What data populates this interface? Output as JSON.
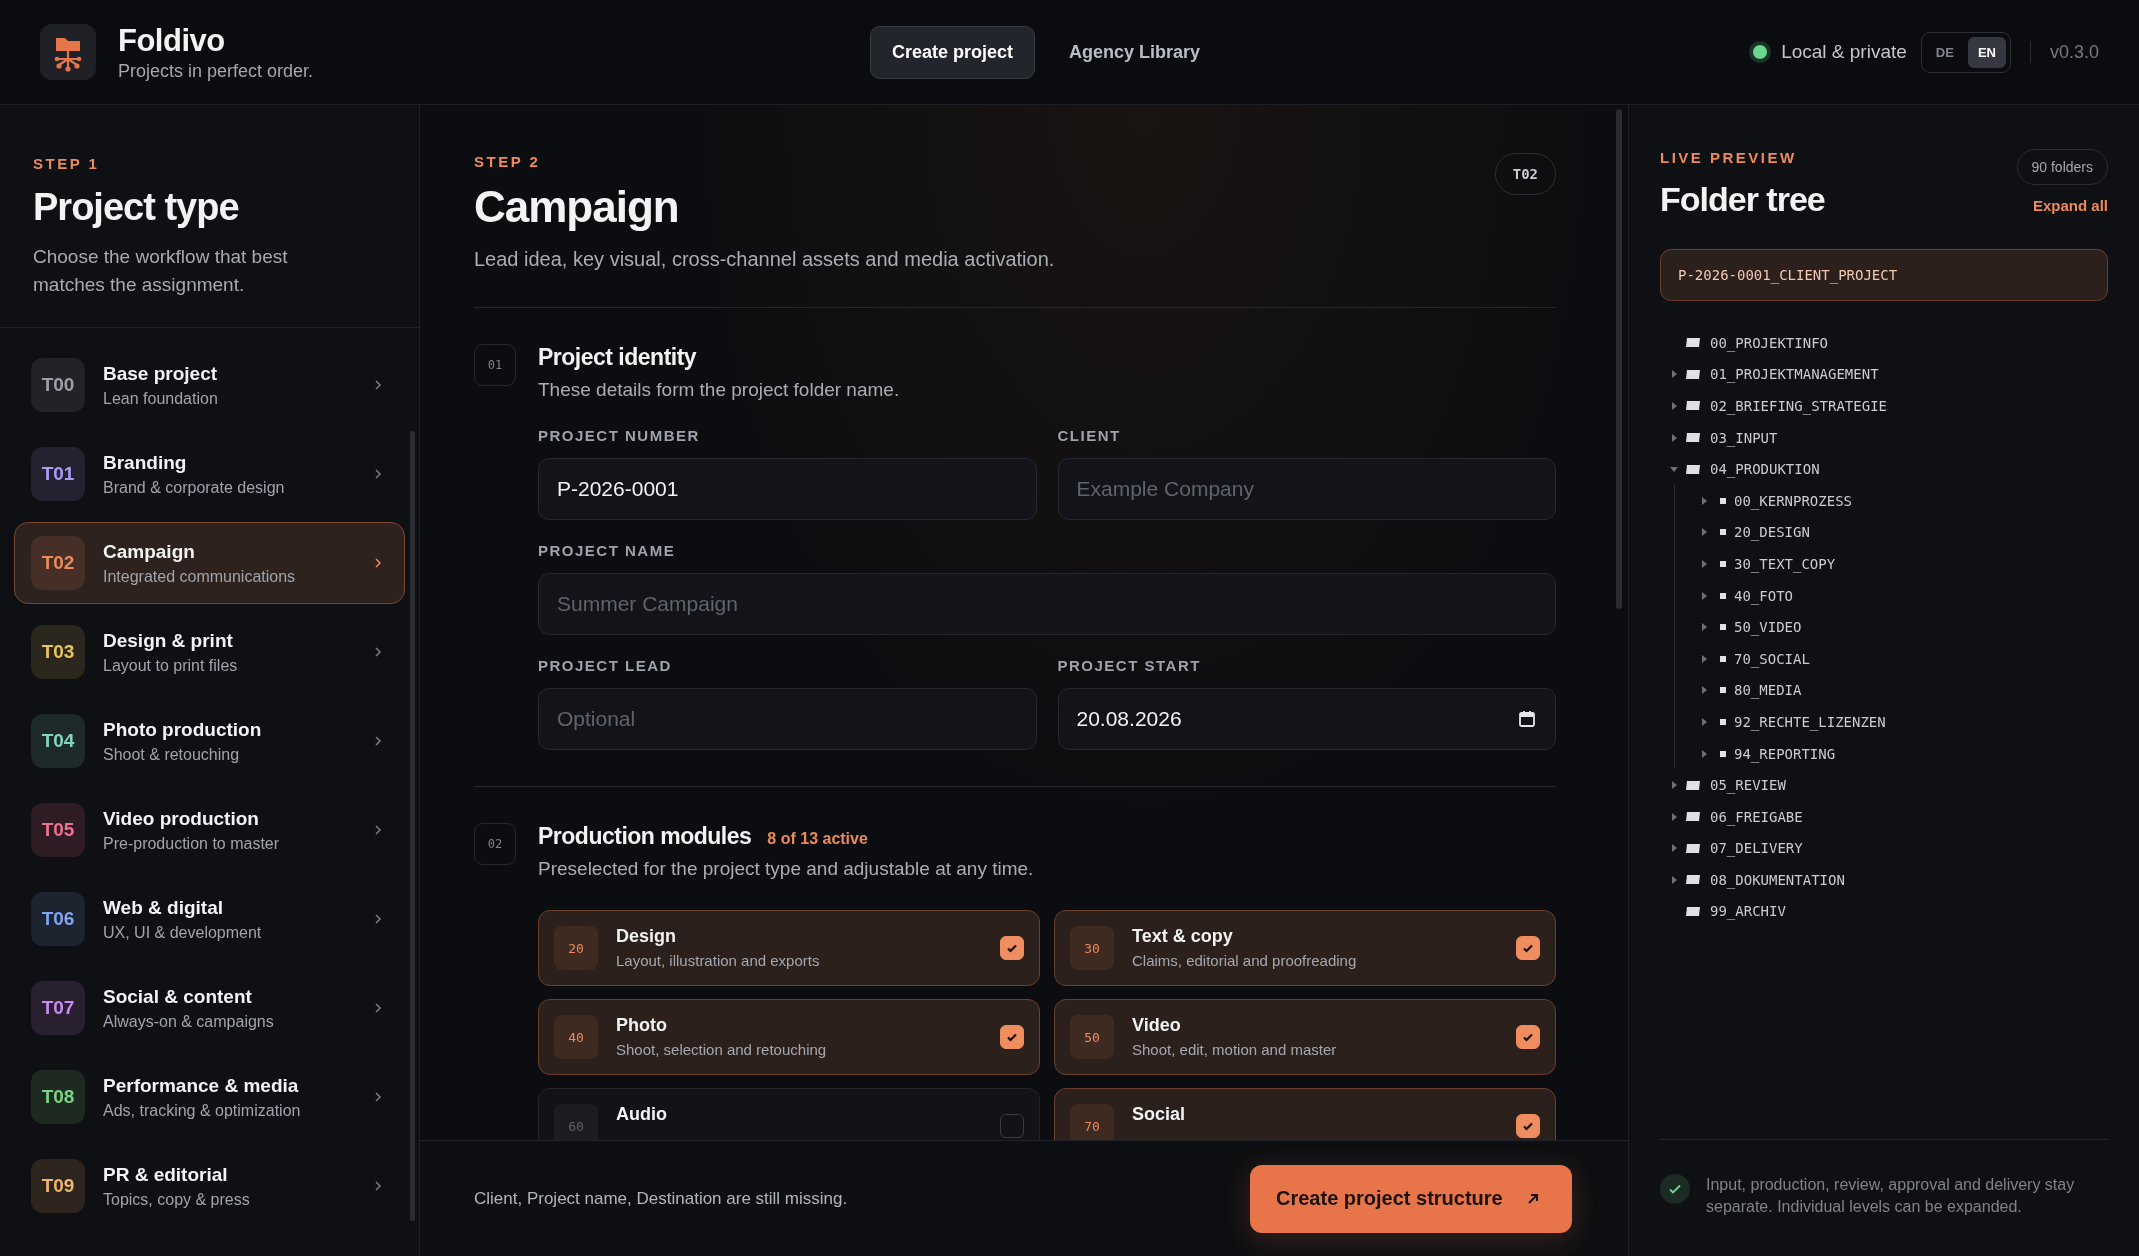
{
  "header": {
    "brand": "Foldivo",
    "tagline": "Projects in perfect order.",
    "nav": [
      {
        "label": "Create project",
        "selected": true
      },
      {
        "label": "Agency Library",
        "selected": false
      }
    ],
    "status": "Local & private",
    "languages": [
      {
        "label": "DE",
        "selected": false
      },
      {
        "label": "EN",
        "selected": true
      }
    ],
    "version": "v0.3.0"
  },
  "sidebar": {
    "step": "STEP 1",
    "title": "Project type",
    "description": "Choose the workflow that best matches the assignment.",
    "items": [
      {
        "code": "T00",
        "title": "Base project",
        "subtitle": "Lean foundation",
        "color": "#9ba0aa",
        "selected": false
      },
      {
        "code": "T01",
        "title": "Branding",
        "subtitle": "Brand & corporate design",
        "color": "#a99cf5",
        "selected": false
      },
      {
        "code": "T02",
        "title": "Campaign",
        "subtitle": "Integrated communications",
        "color": "#ec8a5b",
        "selected": true
      },
      {
        "code": "T03",
        "title": "Design & print",
        "subtitle": "Layout to print files",
        "color": "#e8c462",
        "selected": false
      },
      {
        "code": "T04",
        "title": "Photo production",
        "subtitle": "Shoot & retouching",
        "color": "#80d6bf",
        "selected": false
      },
      {
        "code": "T05",
        "title": "Video production",
        "subtitle": "Pre-production to master",
        "color": "#ee6f8f",
        "selected": false
      },
      {
        "code": "T06",
        "title": "Web & digital",
        "subtitle": "UX, UI & development",
        "color": "#7ea3f2",
        "selected": false
      },
      {
        "code": "T07",
        "title": "Social & content",
        "subtitle": "Always-on & campaigns",
        "color": "#c98af0",
        "selected": false
      },
      {
        "code": "T08",
        "title": "Performance & media",
        "subtitle": "Ads, tracking & optimization",
        "color": "#7ad380",
        "selected": false
      },
      {
        "code": "T09",
        "title": "PR & editorial",
        "subtitle": "Topics, copy & press",
        "color": "#eeb66a",
        "selected": false
      }
    ]
  },
  "main": {
    "step": "STEP 2",
    "badge": "T02",
    "title": "Campaign",
    "description": "Lead idea, key visual, cross-channel assets and media activation.",
    "identity": {
      "number": "01",
      "title": "Project identity",
      "subtitle": "These details form the project folder name.",
      "fields": [
        {
          "label": "PROJECT NUMBER",
          "value": "P-2026-0001",
          "kind": "text"
        },
        {
          "label": "CLIENT",
          "placeholder": "Example Company",
          "kind": "text"
        },
        {
          "label": "PROJECT NAME",
          "placeholder": "Summer Campaign",
          "kind": "wide"
        },
        {
          "label": "PROJECT LEAD",
          "placeholder": "Optional",
          "kind": "text"
        },
        {
          "label": "PROJECT START",
          "value": "20.08.2026",
          "kind": "date"
        }
      ]
    },
    "modules": {
      "number": "02",
      "title": "Production modules",
      "count": "8 of 13 active",
      "subtitle": "Preselected for the project type and adjustable at any time.",
      "items": [
        {
          "code": "20",
          "title": "Design",
          "subtitle": "Layout, illustration and exports",
          "checked": true
        },
        {
          "code": "30",
          "title": "Text & copy",
          "subtitle": "Claims, editorial and proofreading",
          "checked": true
        },
        {
          "code": "40",
          "title": "Photo",
          "subtitle": "Shoot, selection and retouching",
          "checked": true
        },
        {
          "code": "50",
          "title": "Video",
          "subtitle": "Shoot, edit, motion and master",
          "checked": true
        },
        {
          "code": "60",
          "title": "Audio",
          "checked": false
        },
        {
          "code": "70",
          "title": "Social",
          "checked": true
        }
      ]
    }
  },
  "footer": {
    "message": "Client, Project name, Destination are still missing.",
    "button": "Create project structure"
  },
  "preview": {
    "step": "LIVE PREVIEW",
    "title": "Folder tree",
    "count": "90 folders",
    "action": "Expand all",
    "root": "P-2026-0001_CLIENT_PROJECT",
    "tree": [
      {
        "name": "00_PROJEKTINFO",
        "expandable": false
      },
      {
        "name": "01_PROJEKTMANAGEMENT",
        "expandable": true,
        "expanded": false
      },
      {
        "name": "02_BRIEFING_STRATEGIE",
        "expandable": true,
        "expanded": false
      },
      {
        "name": "03_INPUT",
        "expandable": true,
        "expanded": false
      },
      {
        "name": "04_PRODUKTION",
        "expandable": true,
        "expanded": true,
        "children": [
          {
            "name": "00_KERNPROZESS",
            "expandable": true,
            "expanded": false
          },
          {
            "name": "20_DESIGN",
            "expandable": true,
            "expanded": false
          },
          {
            "name": "30_TEXT_COPY",
            "expandable": true,
            "expanded": false
          },
          {
            "name": "40_FOTO",
            "expandable": true,
            "expanded": false
          },
          {
            "name": "50_VIDEO",
            "expandable": true,
            "expanded": false
          },
          {
            "name": "70_SOCIAL",
            "expandable": true,
            "expanded": false
          },
          {
            "name": "80_MEDIA",
            "expandable": true,
            "expanded": false
          },
          {
            "name": "92_RECHTE_LIZENZEN",
            "expandable": true,
            "expanded": false
          },
          {
            "name": "94_REPORTING",
            "expandable": true,
            "expanded": false
          }
        ]
      },
      {
        "name": "05_REVIEW",
        "expandable": true,
        "expanded": false
      },
      {
        "name": "06_FREIGABE",
        "expandable": true,
        "expanded": false
      },
      {
        "name": "07_DELIVERY",
        "expandable": true,
        "expanded": false
      },
      {
        "name": "08_DOKUMENTATION",
        "expandable": true,
        "expanded": false
      },
      {
        "name": "99_ARCHIV",
        "expandable": false
      }
    ],
    "note": "Input, production, review, approval and delivery stay separate. Individual levels can be expanded."
  }
}
